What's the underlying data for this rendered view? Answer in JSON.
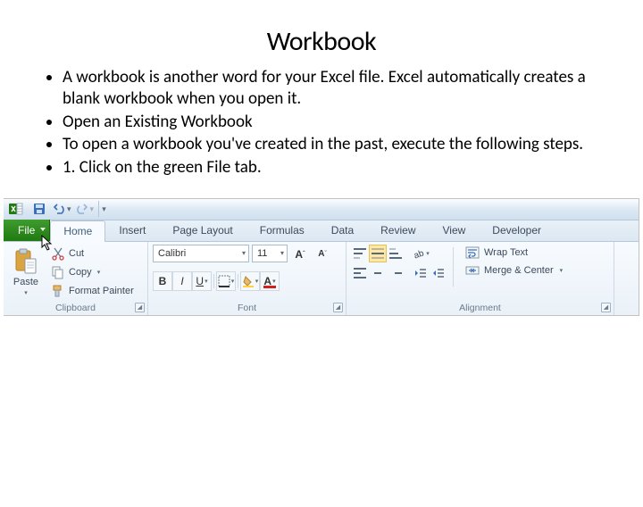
{
  "title": "Workbook",
  "bullets": [
    "A workbook is another word for your Excel file. Excel automatically creates a blank workbook when you open it.",
    "Open an Existing Workbook",
    "To open a workbook you've created in the past, execute the following steps.",
    "1. Click on the green File tab."
  ],
  "ribbon": {
    "tabs": {
      "file": "File",
      "home": "Home",
      "insert": "Insert",
      "page_layout": "Page Layout",
      "formulas": "Formulas",
      "data": "Data",
      "review": "Review",
      "view": "View",
      "developer": "Developer"
    },
    "clipboard": {
      "paste": "Paste",
      "cut": "Cut",
      "copy": "Copy",
      "format_painter": "Format Painter",
      "group": "Clipboard"
    },
    "font": {
      "name": "Calibri",
      "size": "11",
      "group": "Font"
    },
    "alignment": {
      "wrap": "Wrap Text",
      "merge": "Merge & Center",
      "group": "Alignment"
    }
  }
}
